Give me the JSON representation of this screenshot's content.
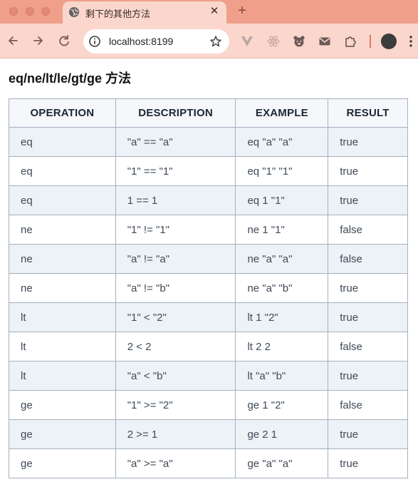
{
  "browser": {
    "tab": {
      "title": "剩下的其他方法",
      "close_glyph": "✕"
    },
    "new_tab_glyph": "+",
    "address_bar": {
      "url": "localhost:8199"
    },
    "colors": {
      "tab_strip": "#ef9f8a",
      "toolbar": "#fbd6cd"
    }
  },
  "page": {
    "title": "eq/ne/lt/le/gt/ge 方法",
    "table": {
      "headers": [
        "OPERATION",
        "DESCRIPTION",
        "EXAMPLE",
        "RESULT"
      ],
      "rows": [
        [
          "eq",
          "\"a\" == \"a\"",
          "eq \"a\" \"a\"",
          "true"
        ],
        [
          "eq",
          "\"1\" == \"1\"",
          "eq \"1\" \"1\"",
          "true"
        ],
        [
          "eq",
          "1 == 1",
          "eq 1 \"1\"",
          "true"
        ],
        [
          "ne",
          "\"1\" != \"1\"",
          "ne 1 \"1\"",
          "false"
        ],
        [
          "ne",
          "\"a\" != \"a\"",
          "ne \"a\" \"a\"",
          "false"
        ],
        [
          "ne",
          "\"a\" != \"b\"",
          "ne \"a\" \"b\"",
          "true"
        ],
        [
          "lt",
          "\"1\" < \"2\"",
          "lt 1 \"2\"",
          "true"
        ],
        [
          "lt",
          "2 < 2",
          "lt 2 2",
          "false"
        ],
        [
          "lt",
          "\"a\" < \"b\"",
          "lt \"a\" \"b\"",
          "true"
        ],
        [
          "ge",
          "\"1\" >= \"2\"",
          "ge 1 \"2\"",
          "false"
        ],
        [
          "ge",
          "2 >= 1",
          "ge 2 1",
          "true"
        ],
        [
          "ge",
          "\"a\" >= \"a\"",
          "ge \"a\" \"a\"",
          "true"
        ]
      ]
    }
  }
}
